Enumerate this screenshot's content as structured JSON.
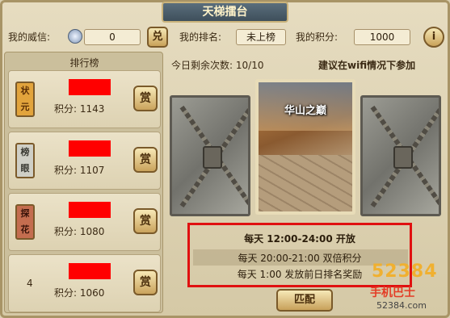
{
  "window": {
    "title": "天梯擂台"
  },
  "header": {
    "prestige_label": "我的威信:",
    "prestige_value": "0",
    "exchange_button": "兑",
    "rank_label": "我的排名:",
    "rank_value": "未上榜",
    "points_label": "我的积分:",
    "points_value": "1000",
    "info_button": "i"
  },
  "leaderboard": {
    "title": "排行榜",
    "score_label": "积分:",
    "reward_button": "赏",
    "rows": [
      {
        "rank": "状元",
        "score": "1143",
        "badge_color": "#e2a43c"
      },
      {
        "rank": "榜眼",
        "score": "1107",
        "badge_color": "#cfcfc6"
      },
      {
        "rank": "探花",
        "score": "1080",
        "badge_color": "#c46d4f"
      },
      {
        "rank": "4",
        "score": "1060",
        "badge_color": ""
      }
    ]
  },
  "info": {
    "remaining_label": "今日剩余次数:",
    "remaining_value": "10/10",
    "wifi_tip": "建议在wifi情况下参加"
  },
  "arena": {
    "center_card_title": "华山之巅"
  },
  "schedule": {
    "line1": "每天 12:00-24:00 开放",
    "line2": "每天 20:00-21:00 双倍积分",
    "line3": "每天 1:00 发放前日排名奖励"
  },
  "actions": {
    "match_button": "匹配"
  },
  "watermark": {
    "logo": "52384",
    "site_name": "手机巴士",
    "url": "52384.com"
  },
  "colors": {
    "highlight_border": "#e01010",
    "redaction": "#ff0000"
  }
}
